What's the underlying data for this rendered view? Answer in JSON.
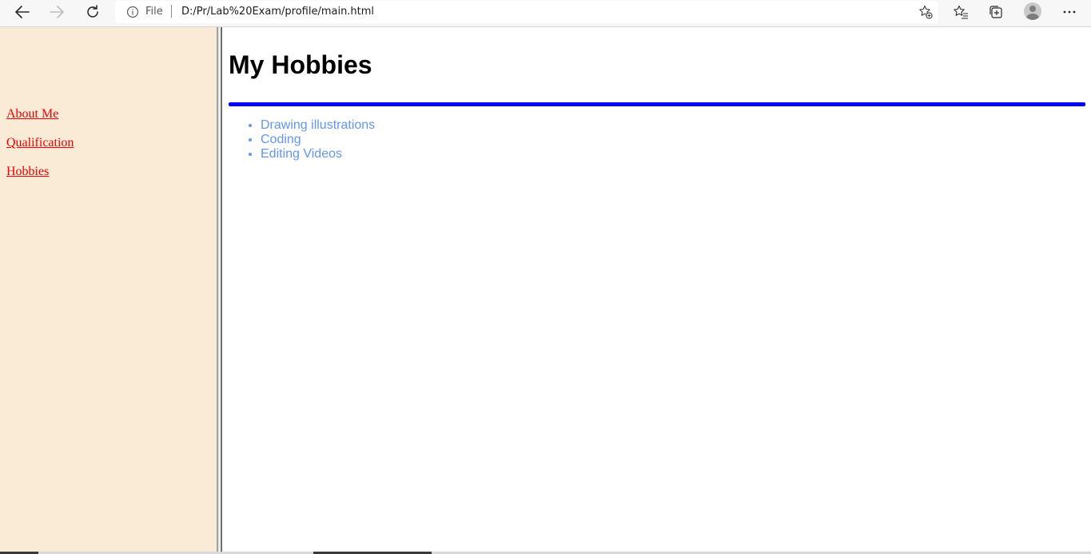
{
  "browser": {
    "back_icon": "arrow-left-icon",
    "forward_icon": "arrow-right-icon",
    "refresh_icon": "refresh-icon",
    "info_icon": "info-icon",
    "file_label": "File",
    "url": "D:/Pr/Lab%20Exam/profile/main.html",
    "add_favorite_icon": "star-plus-icon",
    "favorites_icon": "favorites-icon",
    "collections_icon": "collections-icon",
    "profile_icon": "avatar",
    "menu_icon": "more-icon"
  },
  "sidebar": {
    "background": "#faebd7",
    "link_color": "#ee0000",
    "links": [
      {
        "label": "About Me"
      },
      {
        "label": "Qualification"
      },
      {
        "label": "Hobbies"
      }
    ]
  },
  "main": {
    "title": "My Hobbies",
    "rule_color": "#0000ff",
    "list_color": "#6495ed",
    "hobbies": [
      "Drawing illustrations",
      "Coding",
      "Editing Videos"
    ]
  }
}
